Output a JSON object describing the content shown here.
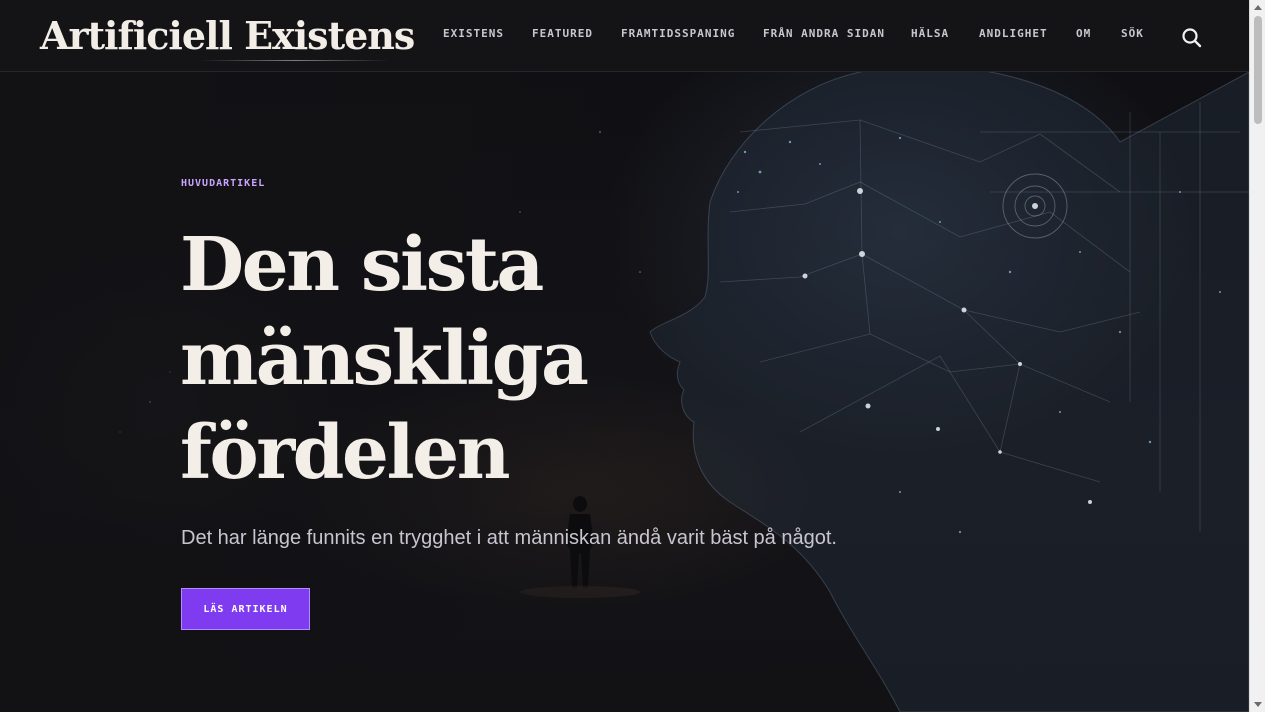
{
  "site": {
    "logo": "Artificiell Existens"
  },
  "nav": {
    "items": [
      {
        "label": "EXISTENS"
      },
      {
        "label": "FEATURED"
      },
      {
        "label": "FRAMTIDSSPANING"
      },
      {
        "label": "FRÅN ANDRA SIDAN"
      },
      {
        "label": "HÄLSA"
      },
      {
        "label": "ANDLIGHET"
      },
      {
        "label": "OM"
      },
      {
        "label": "SÖK"
      }
    ],
    "search_icon": "search-icon"
  },
  "hero": {
    "kicker": "HUVUDARTIKEL",
    "headline_lines": [
      "Den sista",
      "mänskliga",
      "fördelen"
    ],
    "lead": "Det har länge funnits en trygghet i att människan ändå varit bäst på något.",
    "cta_label": "LÄS ARTIKELN",
    "image_subject": "digital-human-head-with-silhouette"
  },
  "colors": {
    "background": "#121215",
    "header": "#141417",
    "accent": "#7f3bef",
    "kicker": "#c9a4ff",
    "headline": "#f3eee8",
    "lead": "#c8c5d0"
  }
}
